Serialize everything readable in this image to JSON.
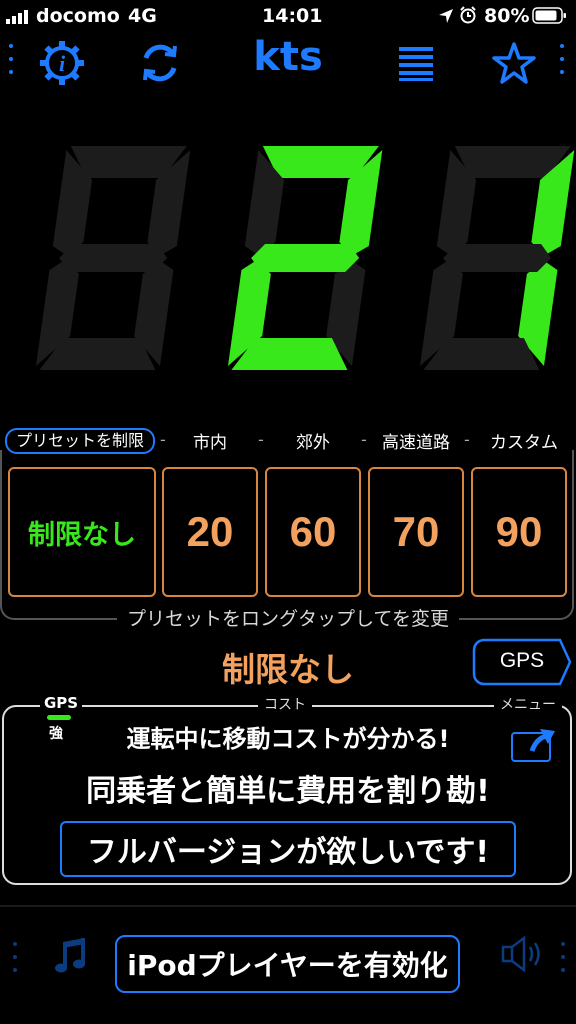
{
  "status": {
    "carrier": "docomo",
    "network": "4G",
    "time": "14:01",
    "battery": "80%"
  },
  "header": {
    "unit": "kts",
    "info_icon": "gear-info-icon",
    "refresh_icon": "refresh-icon",
    "list_icon": "list-icon",
    "star_icon": "star-icon"
  },
  "speed": {
    "value": "21",
    "color": "#39e81b",
    "off_color": "#1c1c1c"
  },
  "presets": {
    "labels": [
      "プリセットを制限",
      "市内",
      "郊外",
      "高速道路",
      "カスタム"
    ],
    "separator": "-",
    "values": [
      "制限なし",
      "20",
      "60",
      "70",
      "90"
    ],
    "hint": "プリセットをロングタップしてを変更"
  },
  "current_limit": "制限なし",
  "gps_button_label": "GPS",
  "cost_panel": {
    "gps_label": "GPS",
    "gps_strength": "強",
    "cost_label": "コスト",
    "menu_label": "メニュー",
    "line1": "運転中に移動コストが分かる!",
    "line2": "同乗者と簡単に費用を割り勘!",
    "full_version": "フルバージョンが欲しいです!"
  },
  "bottom": {
    "ipod_label": "iPodプレイヤーを有効化",
    "music_icon": "music-note-icon",
    "speaker_icon": "speaker-icon"
  },
  "colors": {
    "accent": "#1e7bff",
    "green": "#39e81b",
    "orange": "#f3a15f",
    "border_orange": "#d7863f"
  }
}
